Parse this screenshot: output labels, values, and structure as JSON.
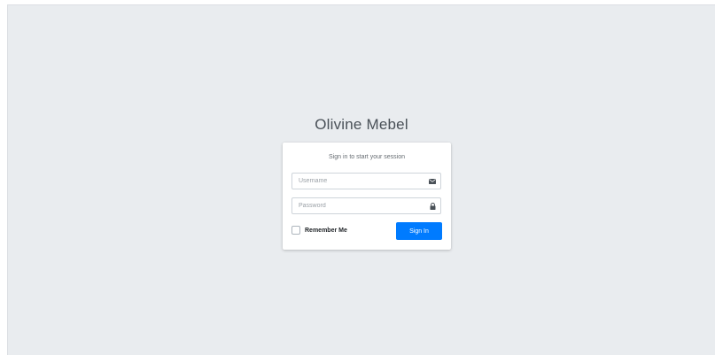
{
  "app": {
    "logo_text": "Olivine Mebel"
  },
  "login": {
    "message": "Sign in to start your session",
    "username": {
      "placeholder": "Username",
      "value": "",
      "icon": "envelope-icon"
    },
    "password": {
      "placeholder": "Password",
      "value": "",
      "icon": "lock-icon"
    },
    "remember_label": "Remember Me",
    "remember_checked": false,
    "submit_label": "Sign In"
  },
  "colors": {
    "background": "#e9ecef",
    "card": "#ffffff",
    "primary": "#007bff",
    "icon": "#495057"
  }
}
